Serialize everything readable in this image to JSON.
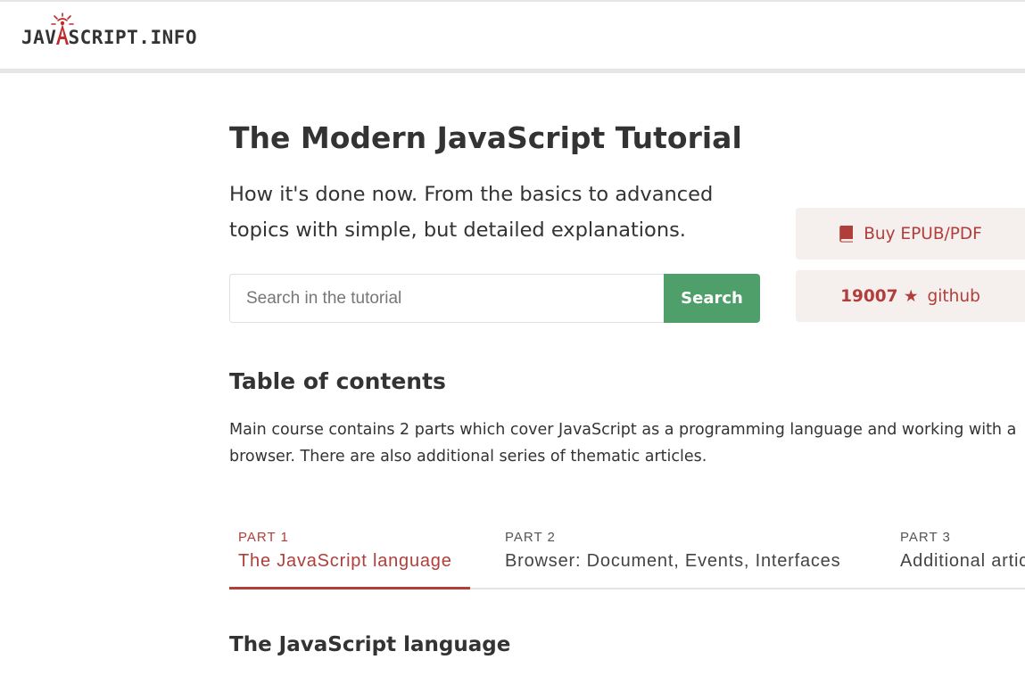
{
  "header": {
    "logo_left": "JAV",
    "logo_right": "SCRIPT.INFO",
    "logo_accent_color": "#c22b2b"
  },
  "hero": {
    "title": "The Modern JavaScript Tutorial",
    "tagline": "How it's done now. From the basics to advanced topics with simple, but detailed explanations."
  },
  "search": {
    "placeholder": "Search in the tutorial",
    "value": "",
    "button_label": "Search"
  },
  "side_buttons": {
    "buy_icon": "book-icon",
    "buy_label": "Buy EPUB/PDF",
    "github_stars": "19007 ★",
    "github_label": "github"
  },
  "toc": {
    "title": "Table of contents",
    "description": "Main course contains 2 parts which cover JavaScript as a programming language and working with a browser. There are also additional series of thematic articles."
  },
  "tabs": [
    {
      "part": "PART 1",
      "label": "The JavaScript language",
      "active": true
    },
    {
      "part": "PART 2",
      "label": "Browser: Document, Events, Interfaces",
      "active": false
    },
    {
      "part": "PART 3",
      "label": "Additional articles",
      "active": false
    }
  ],
  "section": {
    "title": "The JavaScript language"
  },
  "colors": {
    "accent": "#b03e3a",
    "search_button": "#4f9f6a",
    "side_button_bg": "#f5efee",
    "text": "#333333"
  }
}
